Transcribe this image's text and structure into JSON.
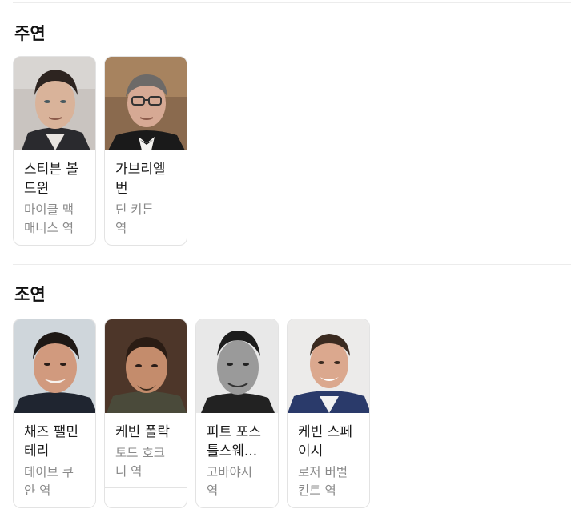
{
  "lead": {
    "title": "주연",
    "cast": [
      {
        "name_line1": "스티븐 볼",
        "name_line2": "드윈",
        "role_line1": "마이클 맥",
        "role_line2": "매너스 역"
      },
      {
        "name_line1": "가브리엘",
        "name_line2": "번",
        "role_line1": "딘 키튼",
        "role_line2": "역"
      }
    ]
  },
  "supporting": {
    "title": "조연",
    "cast": [
      {
        "name_line1": "채즈 팰민",
        "name_line2": "테리",
        "role_line1": "데이브 쿠",
        "role_line2": "얀 역"
      },
      {
        "name_line1": "케빈 폴락",
        "name_line2": "",
        "role_line1": "토드 호크",
        "role_line2": "니 역"
      },
      {
        "name_line1": "피트 포스",
        "name_line2": "틀스웨...",
        "role_line1": "고바야시",
        "role_line2": "역"
      },
      {
        "name_line1": "케빈 스페",
        "name_line2": "이시",
        "role_line1": "로저 버벌",
        "role_line2": "킨트 역"
      }
    ]
  },
  "colors": {
    "name_text": "#1a1a1a",
    "role_text": "#8a8a8a",
    "card_border": "#e3e3e3"
  }
}
